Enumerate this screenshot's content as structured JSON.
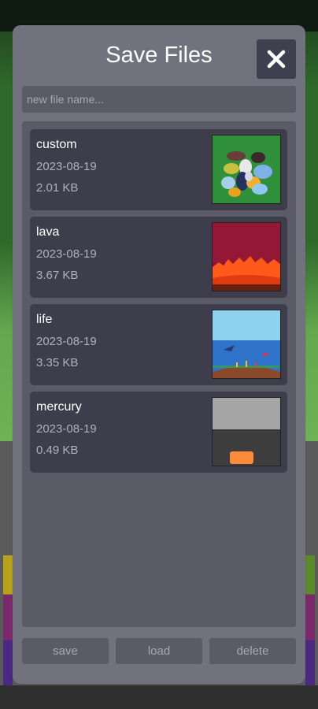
{
  "modal": {
    "title": "Save Files",
    "name_placeholder": "new file name..."
  },
  "files": [
    {
      "name": "custom",
      "date": "2023-08-19",
      "size": "2.01 KB",
      "thumbnail": "custom-thumbnail"
    },
    {
      "name": "lava",
      "date": "2023-08-19",
      "size": "3.67 KB",
      "thumbnail": "lava-thumbnail"
    },
    {
      "name": "life",
      "date": "2023-08-19",
      "size": "3.35 KB",
      "thumbnail": "life-thumbnail"
    },
    {
      "name": "mercury",
      "date": "2023-08-19",
      "size": "0.49 KB",
      "thumbnail": "mercury-thumbnail"
    }
  ],
  "buttons": {
    "save": "save",
    "load": "load",
    "delete": "delete"
  },
  "icons": {
    "close": "close-icon"
  },
  "colors": {
    "modal_bg": "#72727f",
    "panel_bg": "#5b5b68",
    "item_bg": "#3d3d4b",
    "close_bg": "#3f3f4f"
  }
}
